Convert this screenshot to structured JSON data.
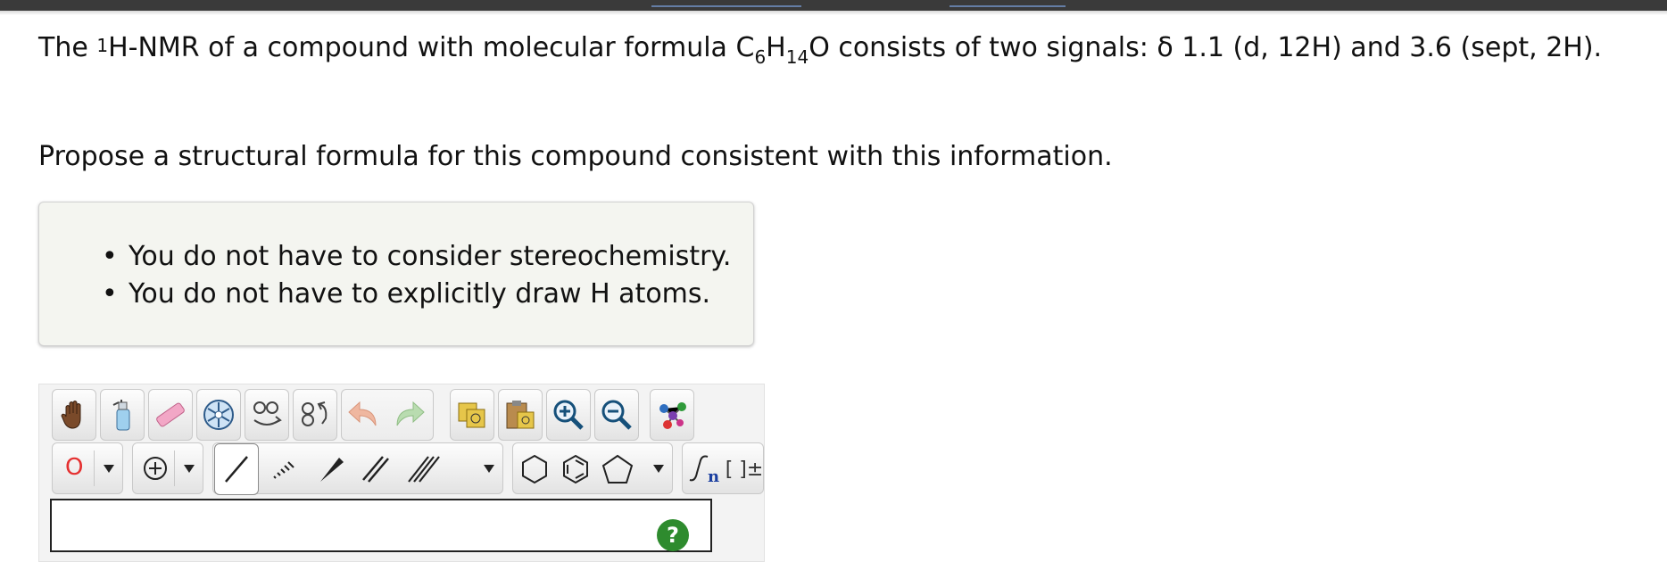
{
  "question": {
    "t1": "The ",
    "sup1": "1",
    "t2": "H-NMR of a compound with molecular formula C",
    "sub6": "6",
    "t3": "H",
    "sub14": "14",
    "t4": "O consists of two signals: δ 1.1 (d, 12H) and 3.6 (sept, 2H).",
    "instruction": "Propose a structural formula for this compound consistent with this information."
  },
  "notes": [
    "You do not have to consider stereochemistry.",
    "You do not have to explicitly draw H atoms."
  ],
  "toolbar": {
    "element_selected": "O",
    "sgroup_label": "n",
    "bracket_label": "[ ]±"
  },
  "help_label": "?",
  "colors": {
    "help_green": "#2e8b2e",
    "element_red": "#e53030"
  }
}
